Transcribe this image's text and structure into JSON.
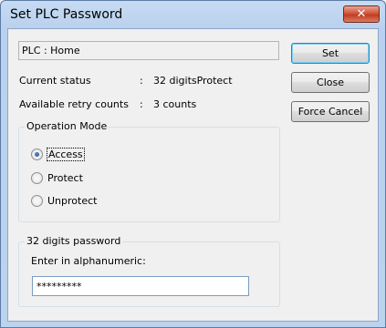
{
  "window": {
    "title": "Set PLC Password",
    "close_symbol": "✕"
  },
  "plc_field": "PLC  :  Home",
  "status": {
    "current_label": "Current status",
    "current_sep": ":",
    "current_value": "32 digitsProtect",
    "retry_label": "Available retry counts",
    "retry_sep": ":",
    "retry_value": "3 counts"
  },
  "operation_mode": {
    "title": "Operation Mode",
    "options": [
      {
        "label": "Access",
        "selected": true
      },
      {
        "label": "Protect",
        "selected": false
      },
      {
        "label": "Unprotect",
        "selected": false
      }
    ]
  },
  "password": {
    "group_title": "32 digits password",
    "prompt": "Enter in alphanumeric:",
    "value": "*********"
  },
  "buttons": {
    "set": "Set",
    "close": "Close",
    "force_cancel": "Force Cancel"
  }
}
